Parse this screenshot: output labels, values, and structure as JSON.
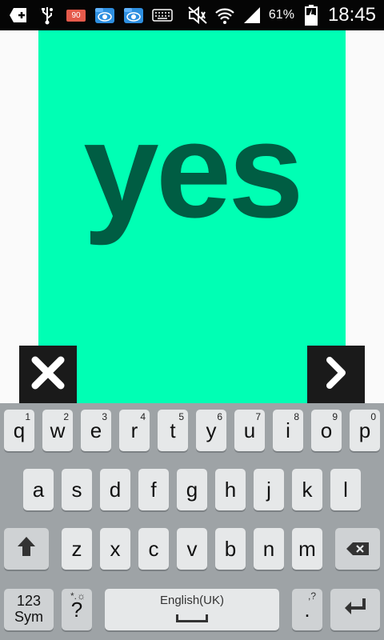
{
  "status_bar": {
    "badge_number": "90",
    "battery_percent": "61%",
    "time": "18:45",
    "icons": [
      "plus-box-icon",
      "usb-icon",
      "notification-badge",
      "es-file-icon",
      "es-file-icon",
      "keyboard-icon",
      "mute-icon",
      "wifi-icon",
      "signal-icon",
      "battery-charging-icon"
    ]
  },
  "flashcard": {
    "word": "yes",
    "background_color": "#00ffb4",
    "text_color": "#005d43"
  },
  "controls": {
    "close_icon": "close-icon",
    "next_icon": "chevron-right-icon"
  },
  "keyboard": {
    "row1": [
      {
        "label": "q",
        "sub": "1"
      },
      {
        "label": "w",
        "sub": "2"
      },
      {
        "label": "e",
        "sub": "3"
      },
      {
        "label": "r",
        "sub": "4"
      },
      {
        "label": "t",
        "sub": "5"
      },
      {
        "label": "y",
        "sub": "6"
      },
      {
        "label": "u",
        "sub": "7"
      },
      {
        "label": "i",
        "sub": "8"
      },
      {
        "label": "o",
        "sub": "9"
      },
      {
        "label": "p",
        "sub": "0"
      }
    ],
    "row2": [
      "a",
      "s",
      "d",
      "f",
      "g",
      "h",
      "j",
      "k",
      "l"
    ],
    "row3": [
      "z",
      "x",
      "c",
      "v",
      "b",
      "n",
      "m"
    ],
    "sym_label_line1": "123",
    "sym_label_line2": "Sym",
    "question_key": "?",
    "question_key_sub": "*.☼",
    "space_label": "English(UK)",
    "period_key": ".",
    "period_key_sub": ",?"
  }
}
